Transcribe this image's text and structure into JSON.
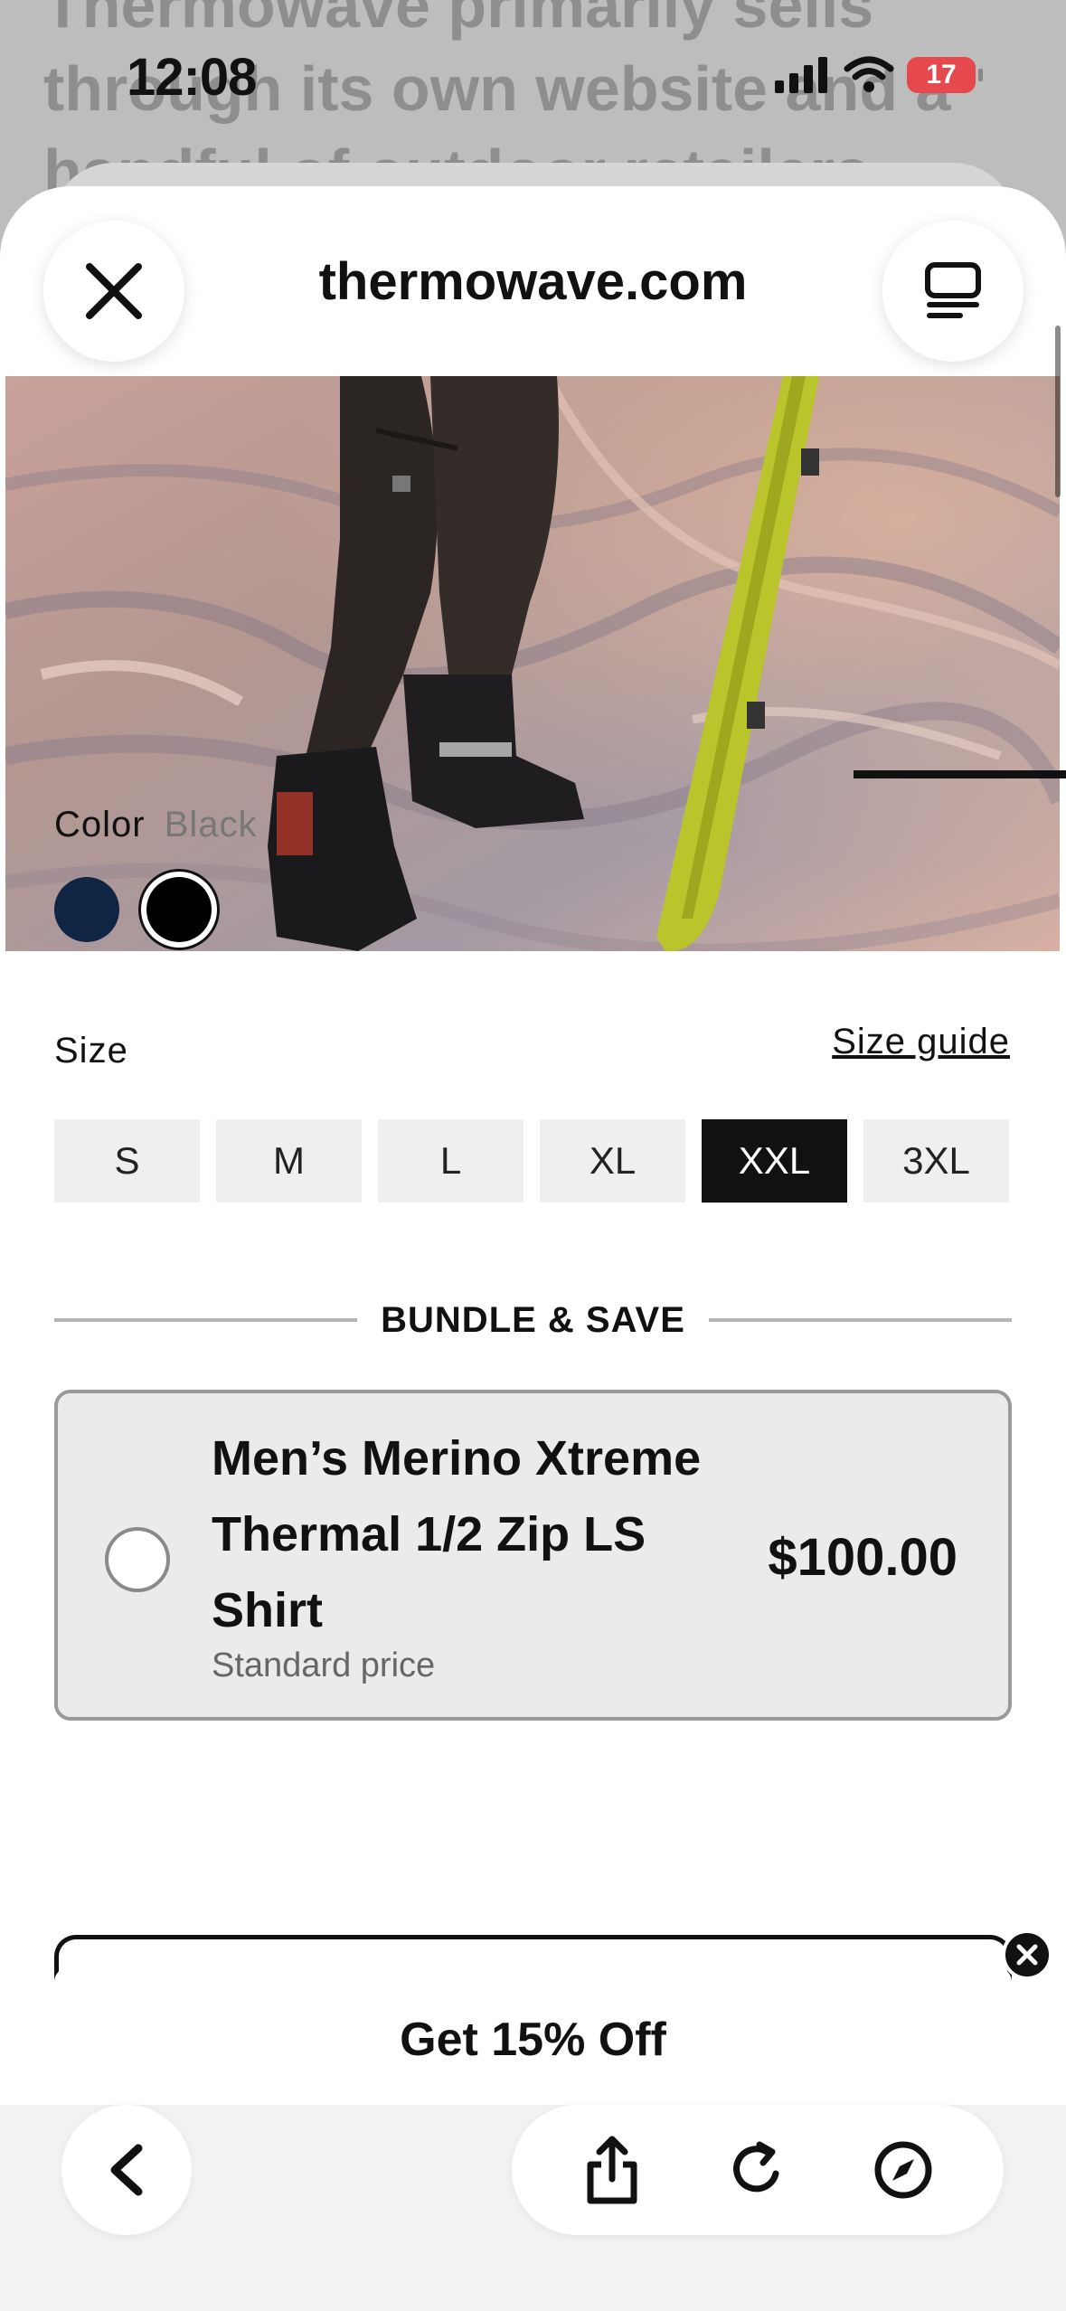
{
  "background": {
    "lines": [
      "Thermowave primarily sells",
      "through its own website and a",
      "handful of outdoor retailers rather"
    ]
  },
  "status": {
    "time": "12:08",
    "battery": "17"
  },
  "header": {
    "domain": "thermowave.com"
  },
  "product": {
    "color_label": "Color",
    "color_value": "Black",
    "swatches": [
      {
        "name": "Navy",
        "hex": "#102443"
      },
      {
        "name": "Black",
        "hex": "#000000"
      }
    ],
    "size_label": "Size",
    "size_guide": "Size guide",
    "sizes": [
      "S",
      "M",
      "L",
      "XL",
      "XXL",
      "3XL"
    ],
    "selected_size": "XXL"
  },
  "bundle": {
    "heading": "BUNDLE & SAVE",
    "option": {
      "title": "Men’s Merino Xtreme Thermal 1/2 Zip LS Shirt",
      "subtitle": "Standard price",
      "price": "$100.00"
    }
  },
  "promo": {
    "label": "Get 15% Off"
  },
  "toolbar": {
    "icons": [
      "back-icon",
      "share-icon",
      "reload-icon",
      "compass-icon"
    ]
  }
}
